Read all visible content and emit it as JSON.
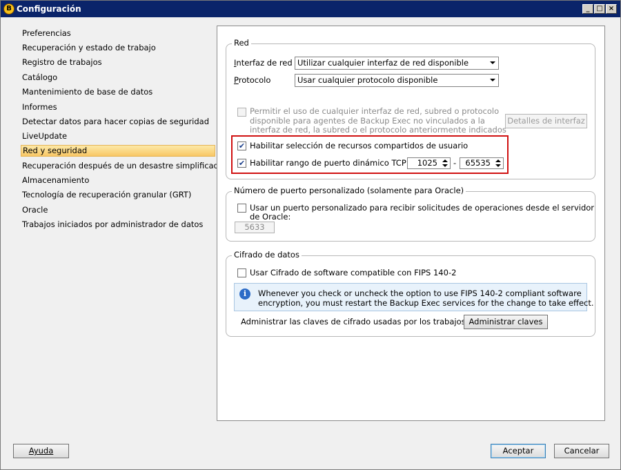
{
  "window": {
    "title": "Configuración",
    "controls": {
      "minimize": "_",
      "maximize": "□",
      "close": "×"
    }
  },
  "sidebar": {
    "items": [
      {
        "label": "Preferencias",
        "selected": false
      },
      {
        "label": "Recuperación y estado de trabajo",
        "selected": false
      },
      {
        "label": "Registro de trabajos",
        "selected": false
      },
      {
        "label": "Catálogo",
        "selected": false
      },
      {
        "label": "Mantenimiento de base de datos",
        "selected": false
      },
      {
        "label": "Informes",
        "selected": false
      },
      {
        "label": "Detectar datos para hacer copias de seguridad",
        "selected": false
      },
      {
        "label": "LiveUpdate",
        "selected": false
      },
      {
        "label": "Red y seguridad",
        "selected": true
      },
      {
        "label": "Recuperación después de un desastre simplificada",
        "selected": false
      },
      {
        "label": "Almacenamiento",
        "selected": false
      },
      {
        "label": "Tecnología de recuperación granular (GRT)",
        "selected": false
      },
      {
        "label": "Oracle",
        "selected": false
      },
      {
        "label": "Trabajos iniciados por administrador de datos",
        "selected": false
      }
    ]
  },
  "network": {
    "legend": "Red",
    "interface_label": "Interfaz de red",
    "interface_value": "Utilizar cualquier interfaz de red disponible",
    "protocol_label": "Protocolo",
    "protocol_value": "Usar cualquier protocolo disponible",
    "allow_any": {
      "line1": "Permitir el uso de cualquier interfaz de red, subred o protocolo",
      "line2": "disponible para agentes de Backup Exec no vinculados a la",
      "line3": "interfaz de red, la subred o el protocolo anteriormente indicados",
      "checked": false,
      "enabled": false
    },
    "interface_details_button": "Detalles de interfaz",
    "enable_shared_resources": {
      "label": "Habilitar selección de recursos compartidos de usuario",
      "checked": true
    },
    "enable_dynamic_ports": {
      "label": "Habilitar rango de puerto dinámico TCP:",
      "checked": true,
      "from": "1025",
      "separator": "-",
      "to": "65535"
    }
  },
  "oracle_port": {
    "legend": "Número de puerto personalizado (solamente para Oracle)",
    "use_custom": {
      "line1": "Usar un puerto personalizado para recibir solicitudes de operaciones desde el servidor",
      "line2": "de Oracle:",
      "checked": false
    },
    "port_value": "5633"
  },
  "encryption": {
    "legend": "Cifrado de datos",
    "use_fips": {
      "label": "Usar Cifrado de software compatible con FIPS 140-2",
      "checked": false
    },
    "info": {
      "line1": "Whenever you check or uncheck the option to use FIPS 140-2 compliant software",
      "line2": "encryption, you must restart the Backup Exec services for the change to take effect."
    },
    "manage_keys_label": "Administrar las claves de cifrado usadas por los trabajos:",
    "manage_keys_button": "Administrar claves"
  },
  "footer": {
    "help_button": "Ayuda",
    "ok_button": "Aceptar",
    "cancel_button": "Cancelar"
  },
  "colors": {
    "titlebar": "#0a246a",
    "selection_highlight": "#f8c765",
    "annotation_border": "#d01010",
    "info_background": "#e8f2fb"
  },
  "icons": {
    "app": "backup-exec-icon",
    "info": "info-icon",
    "checkbox_checked": "✔"
  }
}
